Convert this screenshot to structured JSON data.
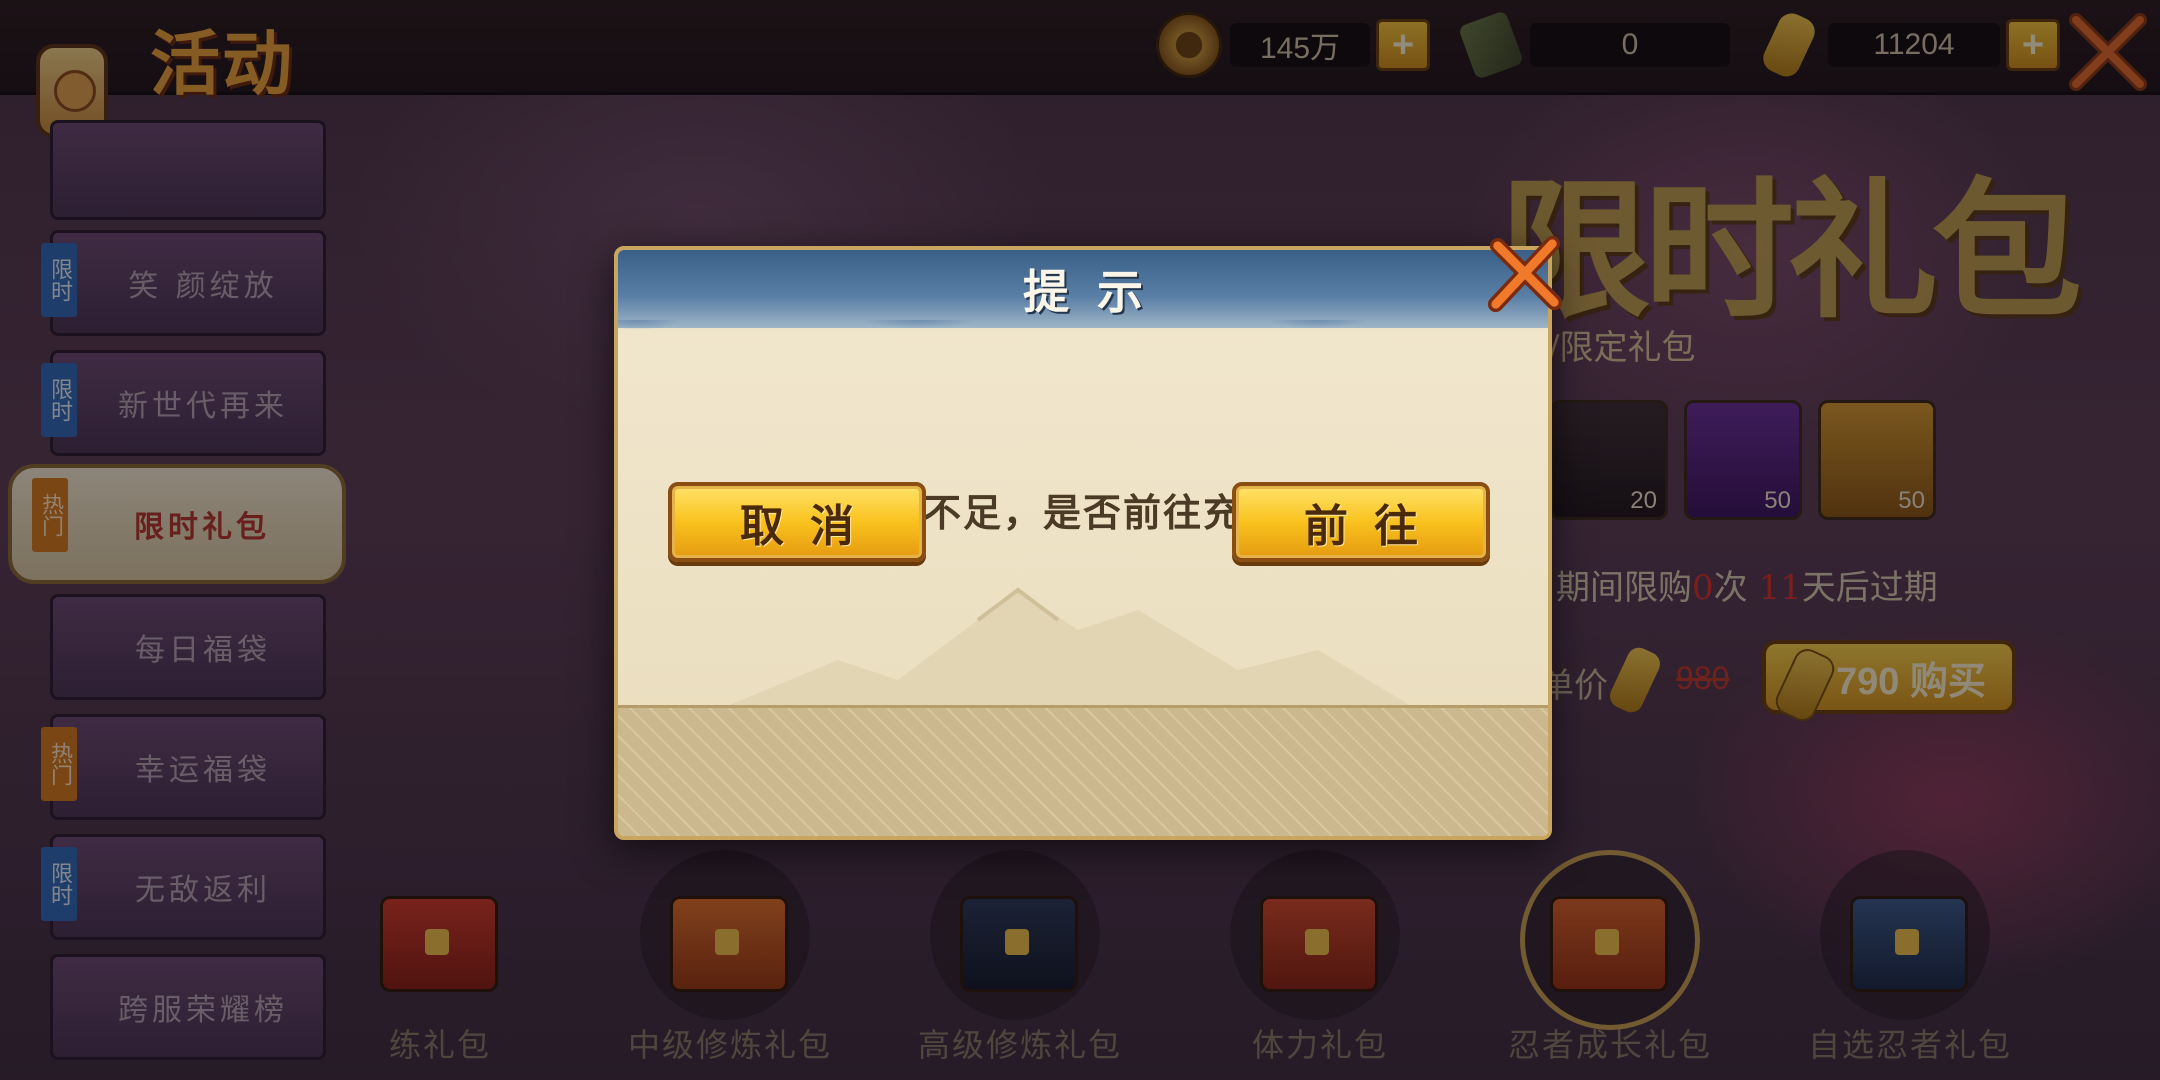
{
  "topbar": {
    "logo": "活动",
    "resources": [
      {
        "icon": "copper-coin-icon",
        "value": "145万"
      },
      {
        "icon": "ticket-icon",
        "value": "0"
      },
      {
        "icon": "gold-ingot-icon",
        "value": "11204"
      }
    ],
    "close_icon": "close-icon"
  },
  "sidebar": {
    "items": [
      {
        "tag": "",
        "label": "",
        "active": false
      },
      {
        "tag": "限时",
        "label": "笑 颜绽放",
        "active": false
      },
      {
        "tag": "限时",
        "label": "新世代再来",
        "active": false
      },
      {
        "tag": "热门",
        "label": "限时礼包",
        "active": true
      },
      {
        "tag": "",
        "label": "每日福袋",
        "active": false
      },
      {
        "tag": "热门",
        "label": "幸运福袋",
        "active": false
      },
      {
        "tag": "限时",
        "label": "无敌返利",
        "active": false
      },
      {
        "tag": "",
        "label": "跨服荣耀榜",
        "active": false
      }
    ]
  },
  "panel": {
    "title": "限时礼包",
    "subtitle": "/限定礼包",
    "items": [
      {
        "icon": "character-portrait-icon",
        "count": "20"
      },
      {
        "icon": "purple-chest-icon",
        "count": "50"
      },
      {
        "icon": "gold-chest-icon",
        "count": "50"
      }
    ],
    "limit_prefix": "期间限购",
    "limit_count": "0",
    "limit_mid": "次  ",
    "limit_days": "11",
    "limit_suffix": "天后过期",
    "price_label": "单价",
    "original_price": "980",
    "buy_label": "790 购买"
  },
  "gifts": [
    {
      "label": "练礼包"
    },
    {
      "label": "中级修炼礼包"
    },
    {
      "label": "高级修炼礼包"
    },
    {
      "label": "体力礼包"
    },
    {
      "label": "忍者成长礼包"
    },
    {
      "label": "自选忍者礼包"
    }
  ],
  "dialog": {
    "title": "提示",
    "message": "元宝不足，是否前往充值？",
    "cancel_label": "取消",
    "confirm_label": "前往",
    "close_icon": "close-icon"
  },
  "colors": {
    "accent_gold": "#f9c21e",
    "dialog_header": "#3a6088",
    "dialog_body": "#f2e8cf",
    "tag_blue": "#2f6ab8",
    "tag_orange": "#d67a1a"
  }
}
